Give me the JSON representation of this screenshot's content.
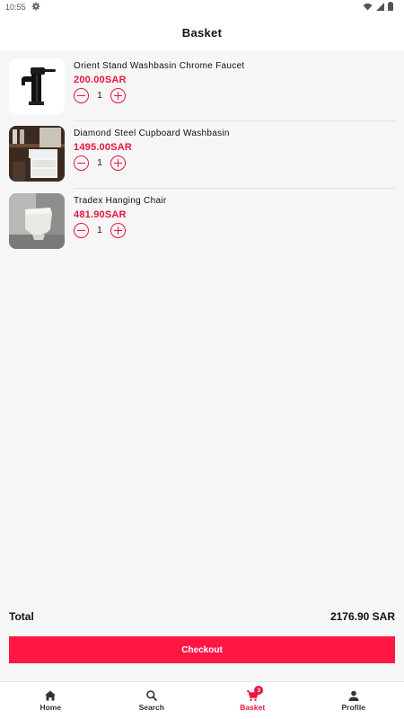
{
  "status_bar": {
    "time": "10:55"
  },
  "header": {
    "title": "Basket"
  },
  "basket": {
    "items": [
      {
        "name": "Orient Stand Washbasin Chrome Faucet",
        "price": "200.00SAR",
        "quantity": "1"
      },
      {
        "name": "Diamond Steel Cupboard Washbasin",
        "price": "1495.00SAR",
        "quantity": "1"
      },
      {
        "name": "Tradex Hanging Chair",
        "price": "481.90SAR",
        "quantity": "1"
      }
    ]
  },
  "total": {
    "label": "Total",
    "value": "2176.90 SAR"
  },
  "checkout": {
    "label": "Checkout"
  },
  "nav": {
    "items": [
      {
        "label": "Home",
        "icon": "home-icon"
      },
      {
        "label": "Search",
        "icon": "search-icon"
      },
      {
        "label": "Basket",
        "icon": "cart-icon",
        "badge": "3"
      },
      {
        "label": "Profile",
        "icon": "profile-icon"
      }
    ],
    "active": "Basket"
  },
  "colors": {
    "accent": "#e8173c",
    "checkout_bg": "#ff1744",
    "background": "#f6f6f6"
  }
}
